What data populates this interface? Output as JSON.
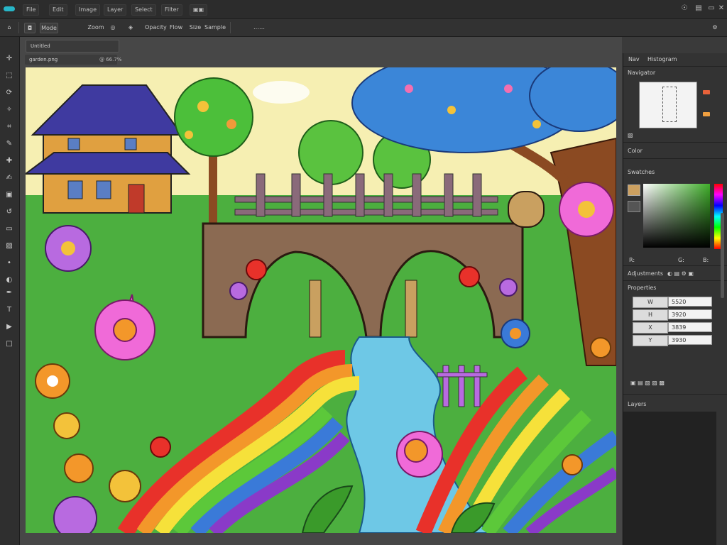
{
  "menubar": {
    "accent": "#27b6c8",
    "menus": [
      "File",
      "Edit",
      "Image",
      "Layer",
      "Select",
      "Filter"
    ],
    "window_icons": [
      "search-icon",
      "panel-icon",
      "minimize-icon",
      "close-icon"
    ]
  },
  "options": {
    "items": [
      "◘",
      "Mode",
      "Zoom",
      "◎",
      "◈",
      "Opacity",
      "Flow",
      "Size",
      "Sample"
    ]
  },
  "tools": [
    "move-icon",
    "marquee-icon",
    "lasso-icon",
    "wand-icon",
    "crop-icon",
    "eyedropper-icon",
    "heal-icon",
    "brush-icon",
    "stamp-icon",
    "history-icon",
    "eraser-icon",
    "gradient-icon",
    "blur-icon",
    "dodge-icon",
    "pen-icon",
    "type-icon",
    "select-icon",
    "shape-icon",
    "hand-icon",
    "zoom-icon"
  ],
  "document": {
    "tab_name": "garden.png",
    "tab_info": "@ 66.7%",
    "doc_box": "Untitled"
  },
  "panels": {
    "tab_a": "Nav",
    "tab_b": "Histogram",
    "navigator_label": "Navigator",
    "color_label": "Color",
    "swatches_label": "Swatches",
    "adjust_label": "Adjustments",
    "properties_label": "Properties",
    "layers_label": "Layers",
    "color_readout_a": "R:",
    "color_readout_b": "G:",
    "color_readout_c": "B:",
    "fg_color": "#cca060",
    "swatch_colors": [
      "#e8623a",
      "#f0a040"
    ],
    "prop_rows": [
      {
        "k": "W",
        "v": "5520"
      },
      {
        "k": "H",
        "v": "3920"
      },
      {
        "k": "X",
        "v": "3839"
      },
      {
        "k": "Y",
        "v": "3930"
      }
    ]
  }
}
